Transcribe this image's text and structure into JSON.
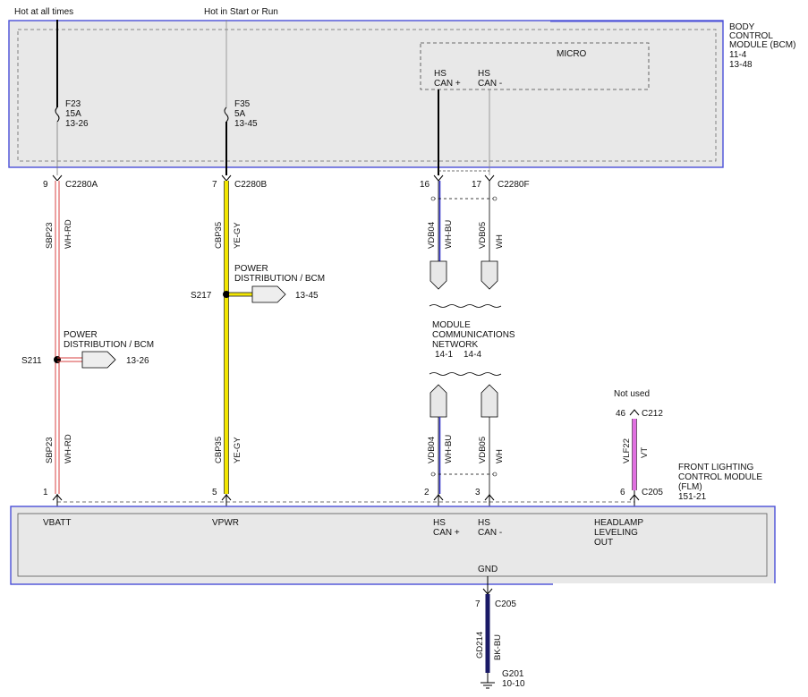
{
  "diagram": {
    "sources": {
      "hot_always": "Hot at all times",
      "hot_start_run": "Hot in Start or Run"
    },
    "bcm": {
      "name_line1": "BODY",
      "name_line2": "CONTROL",
      "name_line3": "MODULE (BCM)",
      "ref1": "11-4",
      "ref2": "13-48",
      "micro": "MICRO",
      "hs_can_plus_1": "HS",
      "hs_can_plus_2": "CAN +",
      "hs_can_minus_1": "HS",
      "hs_can_minus_2": "CAN -"
    },
    "fuses": [
      {
        "id": "F23",
        "rating": "15A",
        "ref": "13-26"
      },
      {
        "id": "F35",
        "rating": "5A",
        "ref": "13-45"
      }
    ],
    "connectors_top": [
      {
        "pin": "9",
        "name": "C2280A"
      },
      {
        "pin": "7",
        "name": "C2280B"
      },
      {
        "pin": "16",
        "name": ""
      },
      {
        "pin": "17",
        "name": "C2280F"
      }
    ],
    "wires": {
      "w1_circuit": "SBP23",
      "w1_color": "WH-RD",
      "w2_circuit": "CBP35",
      "w2_color": "YE-GY",
      "w3_circuit": "VDB04",
      "w3_color": "WH-BU",
      "w4_circuit": "VDB05",
      "w4_color": "WH",
      "w5_circuit": "VLF22",
      "w5_color": "VT",
      "w6_circuit": "GD214",
      "w6_color": "BK-BU"
    },
    "splices": {
      "s217": {
        "id": "S217",
        "label1": "POWER",
        "label2": "DISTRIBUTION / BCM",
        "ref": "13-45"
      },
      "s211": {
        "id": "S211",
        "label1": "POWER",
        "label2": "DISTRIBUTION / BCM",
        "ref": "13-26"
      }
    },
    "network": {
      "line1": "MODULE",
      "line2": "COMMUNICATIONS",
      "line3": "NETWORK",
      "ref1": "14-1",
      "ref2": "14-4"
    },
    "not_used": "Not used",
    "c212": {
      "pin": "46",
      "name": "C212"
    },
    "flm": {
      "name_line1": "FRONT LIGHTING",
      "name_line2": "CONTROL MODULE",
      "name_line3": "(FLM)",
      "ref": "151-21",
      "pins": {
        "p1": "1",
        "p5": "5",
        "p2": "2",
        "p3": "3",
        "p6": "6",
        "conn": "C205"
      },
      "vbatt": "VBATT",
      "vpwr": "VPWR",
      "hs1": "HS",
      "canplus": "CAN +",
      "hs2": "HS",
      "canminus": "CAN -",
      "headlamp1": "HEADLAMP",
      "headlamp2": "LEVELING",
      "headlamp3": "OUT",
      "gnd": "GND"
    },
    "ground": {
      "pin": "7",
      "conn": "C205",
      "id": "G201",
      "ref": "10-10"
    },
    "colors": {
      "module_border": "#4a4fd8",
      "module_fill": "#e8e8e8",
      "wh_rd_stripe": "#d94040",
      "ye_gy": "#f2e600",
      "bu": "#3a3acc",
      "vt": "#e070e0",
      "bk_bu": "#1a1a66"
    }
  }
}
